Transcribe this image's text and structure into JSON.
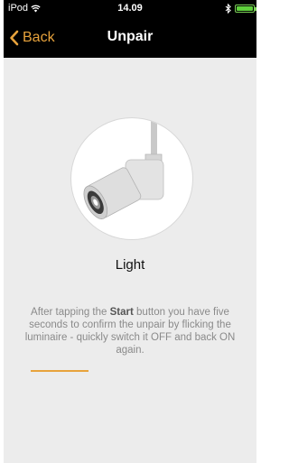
{
  "status_bar": {
    "carrier": "iPod",
    "time": "14.09"
  },
  "nav": {
    "back_label": "Back",
    "title": "Unpair"
  },
  "device": {
    "label": "Light",
    "image_icon": "spotlight-luminaire-icon"
  },
  "instructions": {
    "before": "After tapping the ",
    "emphasis": "Start",
    "after": " button you have five seconds to confirm the unpair by flicking the luminaire - quickly switch it OFF and back ON again."
  },
  "progress": {
    "fraction": 0.29
  },
  "colors": {
    "accent": "#e8a33c",
    "background": "#ececec",
    "bar": "#000000"
  }
}
